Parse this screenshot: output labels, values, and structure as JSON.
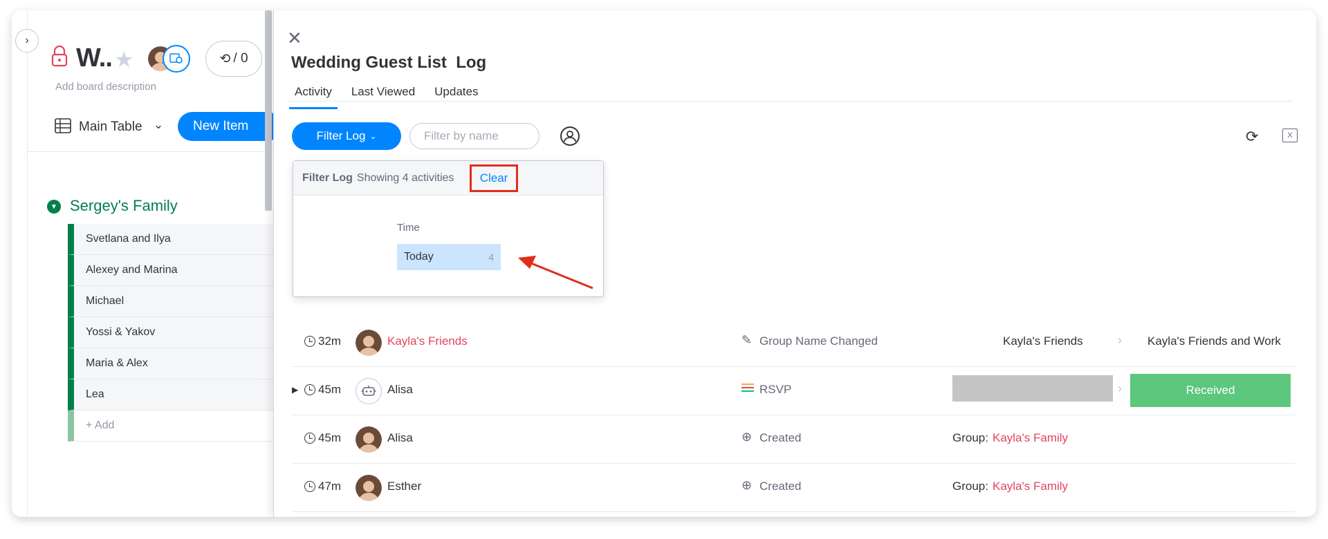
{
  "board": {
    "title": "W..",
    "description": "Add board description",
    "activity_count": "/ 0",
    "view_label": "Main Table",
    "new_item_label": "New Item",
    "group": {
      "title": "Sergey's Family",
      "color": "#037f4c",
      "items": [
        "Svetlana and Ilya",
        "Alexey and Marina",
        "Michael",
        "Yossi & Yakov",
        "Maria & Alex",
        "Lea"
      ],
      "add_label": "+ Add"
    }
  },
  "panel": {
    "title": "Wedding Guest List  Log",
    "tabs": [
      "Activity",
      "Last Viewed",
      "Updates"
    ],
    "active_tab": "Activity",
    "filter_button": "Filter Log",
    "filter_placeholder": "Filter by name",
    "dropdown": {
      "title": "Filter Log",
      "count_text": "Showing 4 activities",
      "clear_label": "Clear",
      "section_label": "Time",
      "option_label": "Today",
      "option_count": "4"
    },
    "rows": [
      {
        "ago": "32m",
        "who": "Kayla's Friends",
        "action": "Group Name Changed",
        "from": "Kayla's Friends",
        "to": "Kayla's Friends and Work"
      },
      {
        "ago": "45m",
        "who": "Alisa",
        "action": "RSVP",
        "to_status": "Received",
        "status_color": "#5cc77d"
      },
      {
        "ago": "45m",
        "who": "Alisa",
        "action": "Created",
        "group_label": "Group:",
        "group_value": "Kayla's Family"
      },
      {
        "ago": "47m",
        "who": "Esther",
        "action": "Created",
        "group_label": "Group:",
        "group_value": "Kayla's Family"
      }
    ]
  },
  "colors": {
    "accent": "#0085ff",
    "highlight_box": "#e22d1b",
    "pink_link": "#e2445c"
  },
  "icons": [
    "lock-icon",
    "star-icon",
    "search-icon",
    "table-icon",
    "chevron-down-icon",
    "close-icon",
    "person-icon",
    "refresh-icon",
    "export-excel-icon",
    "clock-icon",
    "pencil-icon",
    "rsvp-lines-icon",
    "plus-circle-icon",
    "robot-icon"
  ]
}
